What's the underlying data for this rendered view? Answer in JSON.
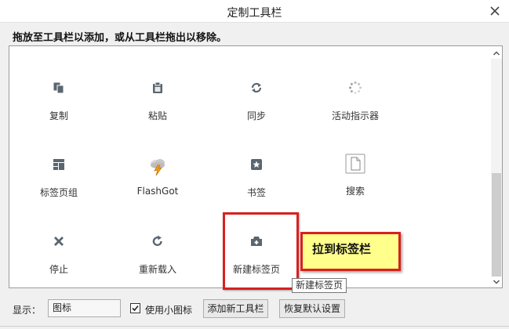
{
  "window": {
    "title": "定制工具栏"
  },
  "instruction": "拖放至工具栏以添加，或从工具栏拖出以移除。",
  "palette": {
    "items": [
      {
        "label": "复制",
        "icon": "copy-icon"
      },
      {
        "label": "粘贴",
        "icon": "paste-icon"
      },
      {
        "label": "同步",
        "icon": "sync-icon"
      },
      {
        "label": "活动指示器",
        "icon": "activity-indicator-icon"
      },
      {
        "label": "标签页组",
        "icon": "tab-groups-icon"
      },
      {
        "label": "FlashGot",
        "icon": "flashgot-icon"
      },
      {
        "label": "书签",
        "icon": "bookmark-star-icon"
      },
      {
        "label": "搜索",
        "icon": "search-page-icon"
      },
      {
        "label": "停止",
        "icon": "stop-x-icon"
      },
      {
        "label": "重新载入",
        "icon": "reload-icon"
      },
      {
        "label": "新建标签页",
        "icon": "new-tab-icon"
      }
    ]
  },
  "callout": {
    "text": "拉到标签栏"
  },
  "tooltip": {
    "text": "新建标签页"
  },
  "bottom": {
    "show_label": "显示：",
    "show_value": "图标",
    "small_icons_label": "使用小图标",
    "small_icons_checked": true,
    "add_toolbar_label": "添加新工具栏",
    "restore_label": "恢复默认设置"
  },
  "colors": {
    "highlight": "#d82020",
    "callout_bg": "#ffff8c",
    "icon": "#5a6670"
  }
}
